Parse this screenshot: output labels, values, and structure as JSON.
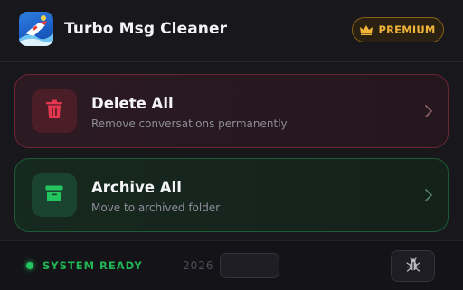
{
  "app": {
    "title": "Turbo Msg Cleaner",
    "icon": "app-logo-icon"
  },
  "premium": {
    "label": "PREMIUM",
    "icon": "crown-icon",
    "color": "#f0b43a"
  },
  "actions": [
    {
      "title": "Delete All",
      "subtitle": "Remove conversations permanently",
      "icon": "trash-icon",
      "accent": "#e5364f"
    },
    {
      "title": "Archive All",
      "subtitle": "Move to archived folder",
      "icon": "archive-box-icon",
      "accent": "#22c55e"
    }
  ],
  "footer": {
    "status": "SYSTEM READY",
    "status_color": "#22c55e",
    "year": "2026",
    "year_value": "",
    "bug_icon": "bug-icon"
  }
}
